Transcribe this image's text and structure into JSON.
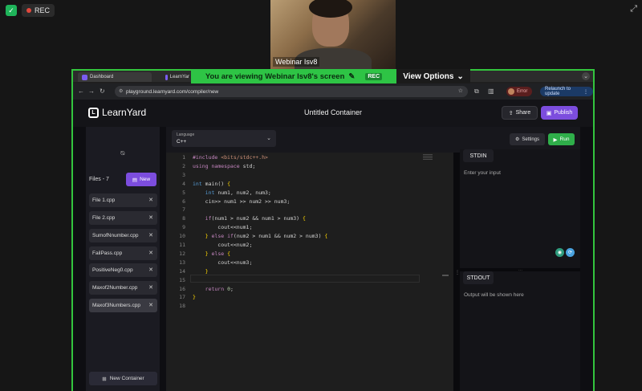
{
  "meeting": {
    "rec_label": "REC",
    "webcam_name": "Webinar Isv8",
    "viewing_text": "You are viewing  Webinar Isv8's screen",
    "viewing_rec": "REC",
    "view_options": "View Options"
  },
  "browser": {
    "tabs": [
      {
        "label": "Dashboard"
      },
      {
        "label": "LearnYar"
      }
    ],
    "url": "playground.learnyard.com/compiler/new",
    "error_label": "Error",
    "relaunch_label": "Relaunch to update"
  },
  "app": {
    "logo_text": "LearnYard",
    "document_title": "Untitled Container",
    "share_label": "Share",
    "publish_label": "Publish"
  },
  "sidebar": {
    "files_count": "Files - 7",
    "new_label": "New",
    "files": [
      {
        "name": "File 1.cpp",
        "active": false
      },
      {
        "name": "File 2.cpp",
        "active": false
      },
      {
        "name": "SumofNnumber.cpp",
        "active": false
      },
      {
        "name": "FailPass.cpp",
        "active": false
      },
      {
        "name": "PositiveNeg0.cpp",
        "active": false
      },
      {
        "name": "Maxof2Number.cpp",
        "active": false
      },
      {
        "name": "Maxof3Numbers.cpp",
        "active": true
      }
    ],
    "new_container_label": "New Container"
  },
  "editor": {
    "language_label": "Language",
    "language_value": "C++",
    "settings_label": "Settings",
    "run_label": "Run",
    "lines": [
      "#include <bits/stdc++.h>",
      "using namespace std;",
      "",
      "int main() {",
      "    int num1, num2, num3;",
      "    cin>> num1 >> num2 >> num3;",
      "",
      "    if(num1 > num2 && num1 > num3) {",
      "        cout<<num1;",
      "    } else if(num2 > num1 && num2 > num3) {",
      "        cout<<num2;",
      "    } else {",
      "        cout<<num3;",
      "    }",
      "",
      "    return 0;",
      "}",
      ""
    ]
  },
  "io": {
    "stdin_label": "STDIN",
    "stdin_placeholder": "Enter your input",
    "stdout_label": "STDOUT",
    "stdout_placeholder": "Output will be shown here"
  }
}
